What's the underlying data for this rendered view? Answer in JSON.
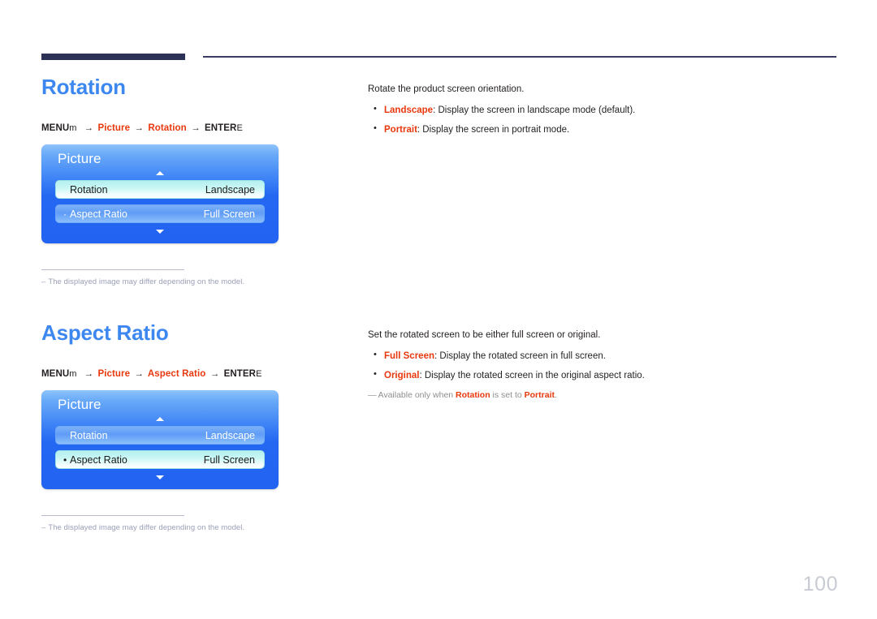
{
  "page": {
    "number": "100"
  },
  "sections": [
    {
      "id": "rotation",
      "heading": "Rotation",
      "breadcrumb": {
        "menu_label": "MENU",
        "menu_key_glyph": "m",
        "arrow": "→",
        "crumb1": "Picture",
        "crumb2": "Rotation",
        "enter_label": "ENTER",
        "enter_key_glyph": "E"
      },
      "osd": {
        "title": "Picture",
        "up_arrow_icon": "caret-up-icon",
        "down_arrow_icon": "caret-down-icon",
        "rows": [
          {
            "bullet": "",
            "label": "Rotation",
            "value": "Landscape",
            "state": "selected"
          },
          {
            "bullet": "·",
            "label": "Aspect Ratio",
            "value": "Full Screen",
            "state": "unselected"
          }
        ]
      },
      "footnote": {
        "dash": "–",
        "text": "The displayed image may differ depending on the model."
      },
      "description": {
        "lead": "Rotate the product screen orientation.",
        "items": [
          {
            "term": "Landscape",
            "text": ": Display the screen in landscape mode (default)."
          },
          {
            "term": "Portrait",
            "text": ": Display the screen in portrait mode."
          }
        ],
        "note": null
      }
    },
    {
      "id": "aspect",
      "heading": "Aspect Ratio",
      "breadcrumb": {
        "menu_label": "MENU",
        "menu_key_glyph": "m",
        "arrow": "→",
        "crumb1": "Picture",
        "crumb2": "Aspect Ratio",
        "enter_label": "ENTER",
        "enter_key_glyph": "E"
      },
      "osd": {
        "title": "Picture",
        "up_arrow_icon": "caret-up-icon",
        "down_arrow_icon": "caret-down-icon",
        "rows": [
          {
            "bullet": "",
            "label": "Rotation",
            "value": "Landscape",
            "state": "unselected"
          },
          {
            "bullet": "•",
            "label": "Aspect Ratio",
            "value": "Full Screen",
            "state": "selected"
          }
        ]
      },
      "footnote": {
        "dash": "–",
        "text": "The displayed image may differ depending on the model."
      },
      "description": {
        "lead": "Set the rotated screen to be either full screen or original.",
        "items": [
          {
            "term": "Full Screen",
            "text": ": Display the rotated screen in full screen."
          },
          {
            "term": "Original",
            "text": ": Display the rotated screen in the original aspect ratio."
          }
        ],
        "note": {
          "dash": "—",
          "prefix": "Available only when ",
          "term1": "Rotation",
          "middle": " is set to ",
          "term2": "Portrait",
          "suffix": "."
        }
      }
    }
  ],
  "colors": {
    "heading_blue": "#3d88f0",
    "accent_red": "#e8380d",
    "rule_navy": "#2e3157",
    "osd_blue": "#2468f2",
    "osd_selected_cyan": "#c9f6f4",
    "page_number_gray": "#c9cbd4"
  }
}
